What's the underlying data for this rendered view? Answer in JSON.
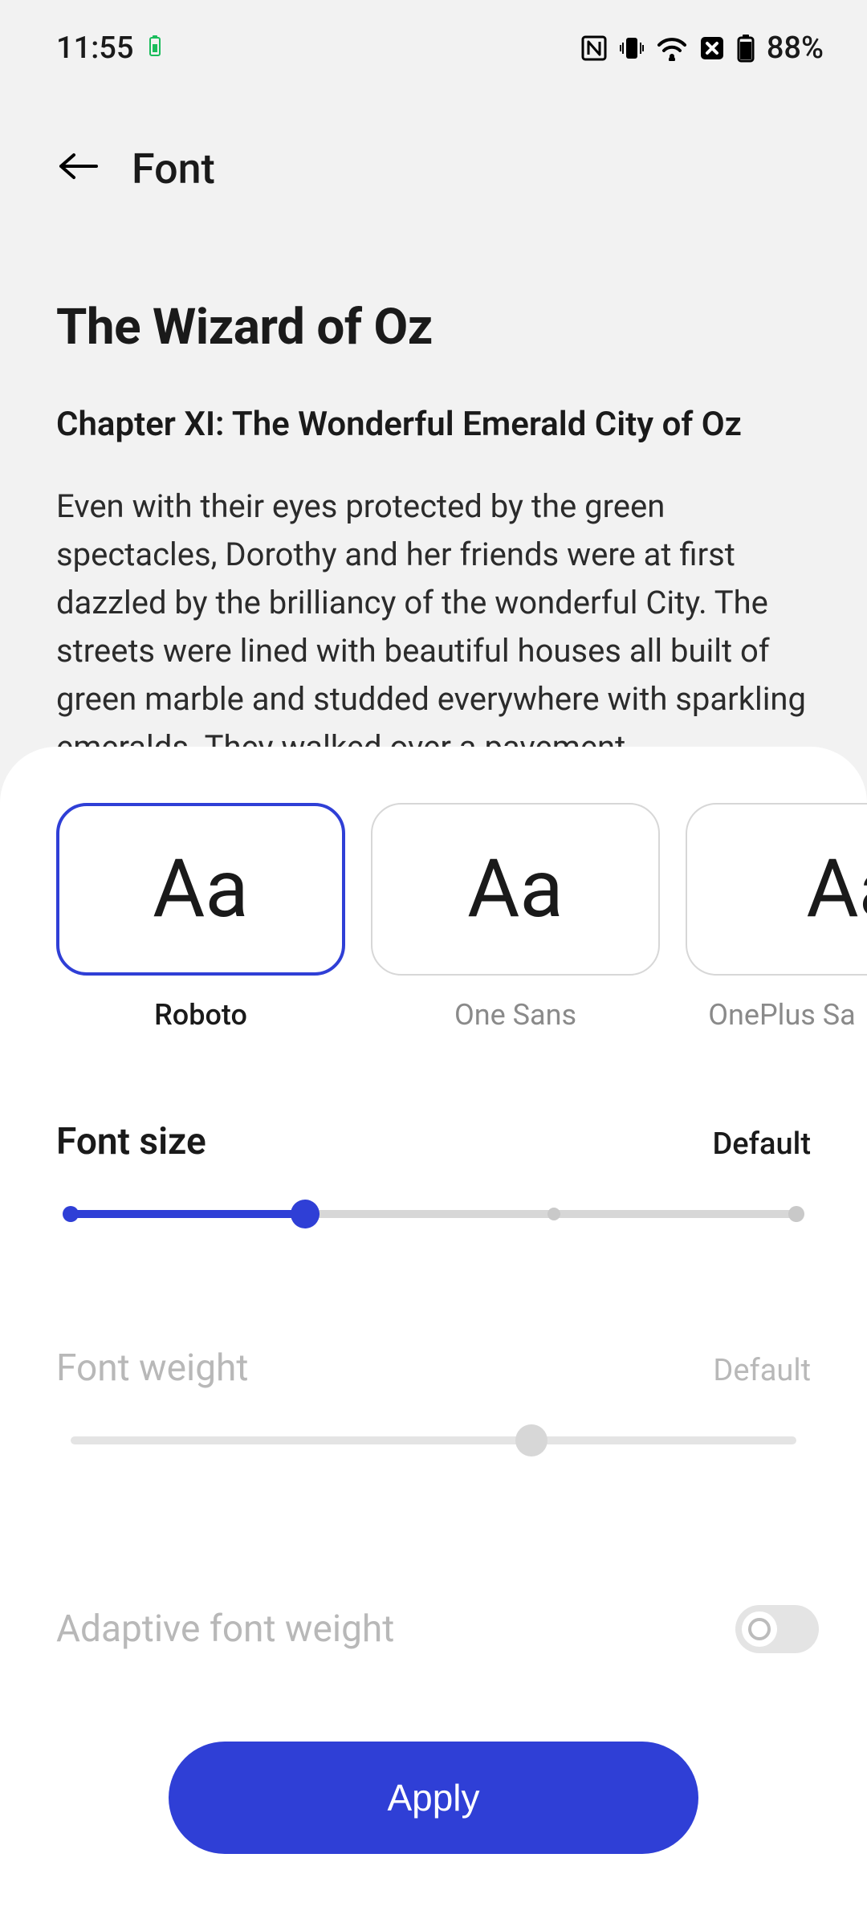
{
  "status": {
    "time": "11:55",
    "battery_percent": "88%",
    "icons": {
      "nfc": "nfc",
      "vibrate": "vibrate",
      "wifi": "wifi",
      "dnd": "dnd",
      "battery": "battery"
    }
  },
  "header": {
    "title": "Font"
  },
  "preview": {
    "title": "The Wizard of Oz",
    "subtitle": "Chapter XI: The Wonderful Emerald City of Oz",
    "body": "Even with their eyes protected by the green spectacles, Dorothy and her friends were at first dazzled by the brilliancy of the wonderful City. The streets were lined with beautiful houses all built of green marble and studded everywhere with sparkling emeralds. They walked over a pavement"
  },
  "fonts": {
    "sample": "Aa",
    "options": [
      {
        "label": "Roboto",
        "selected": true
      },
      {
        "label": "One Sans",
        "selected": false
      },
      {
        "label": "OnePlus Sa",
        "selected": false
      }
    ]
  },
  "size_slider": {
    "title": "Font size",
    "value_label": "Default",
    "percent": 33,
    "default_tick_percent": 66,
    "enabled": true
  },
  "weight_slider": {
    "title": "Font weight",
    "value_label": "Default",
    "percent": 63,
    "enabled": false
  },
  "adaptive": {
    "label": "Adaptive font weight",
    "on": false,
    "enabled": false
  },
  "apply_label": "Apply",
  "colors": {
    "accent": "#2f3fd6"
  }
}
